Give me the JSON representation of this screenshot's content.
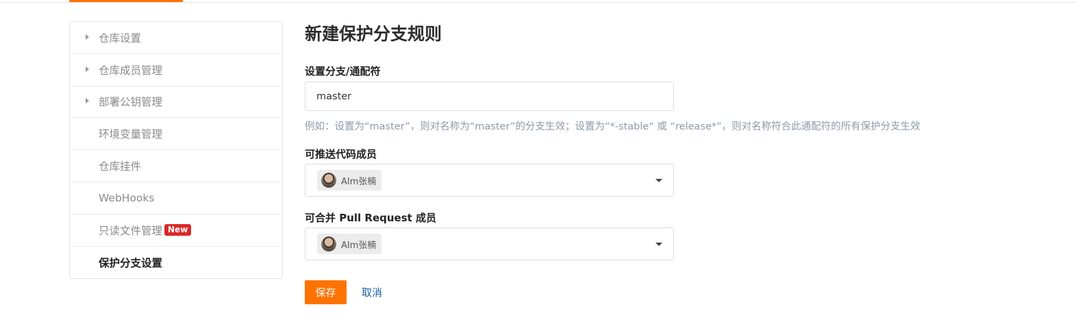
{
  "sidebar": {
    "items": [
      {
        "label": "仓库设置"
      },
      {
        "label": "仓库成员管理"
      },
      {
        "label": "部署公钥管理"
      },
      {
        "label": "环境变量管理"
      },
      {
        "label": "仓库挂件"
      },
      {
        "label": "WebHooks"
      },
      {
        "label": "只读文件管理",
        "badge": "New"
      },
      {
        "label": "保护分支设置"
      }
    ]
  },
  "main": {
    "title": "新建保护分支规则",
    "branch": {
      "label": "设置分支/通配符",
      "value": "master",
      "hint": "例如：设置为“master”，则对名称为“master”的分支生效；设置为“*-stable“ 或 “release*”，则对名称符合此通配符的所有保护分支生效"
    },
    "pushers": {
      "label": "可推送代码成员",
      "member": "AIm张楠"
    },
    "mergers": {
      "label": "可合并 Pull Request 成员",
      "member": "AIm张楠"
    },
    "actions": {
      "save": "保存",
      "cancel": "取消"
    }
  },
  "colors": {
    "accent": "#fe7300",
    "badge": "#db2828",
    "link": "#1e5fa3"
  }
}
